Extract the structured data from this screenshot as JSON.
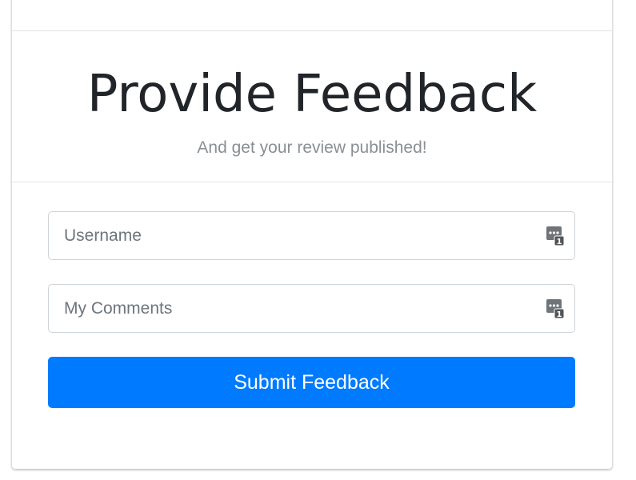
{
  "header": {
    "title": "Provide Feedback",
    "subtitle": "And get your review published!"
  },
  "form": {
    "username": {
      "placeholder": "Username",
      "value": "",
      "icon": "password-manager-icon"
    },
    "comments": {
      "placeholder": "My Comments",
      "value": "",
      "icon": "password-manager-icon"
    },
    "submit_label": "Submit Feedback"
  },
  "colors": {
    "primary": "#007bff",
    "title": "#212529",
    "subtitle": "#8a8f94",
    "border": "#cfd4d9"
  }
}
